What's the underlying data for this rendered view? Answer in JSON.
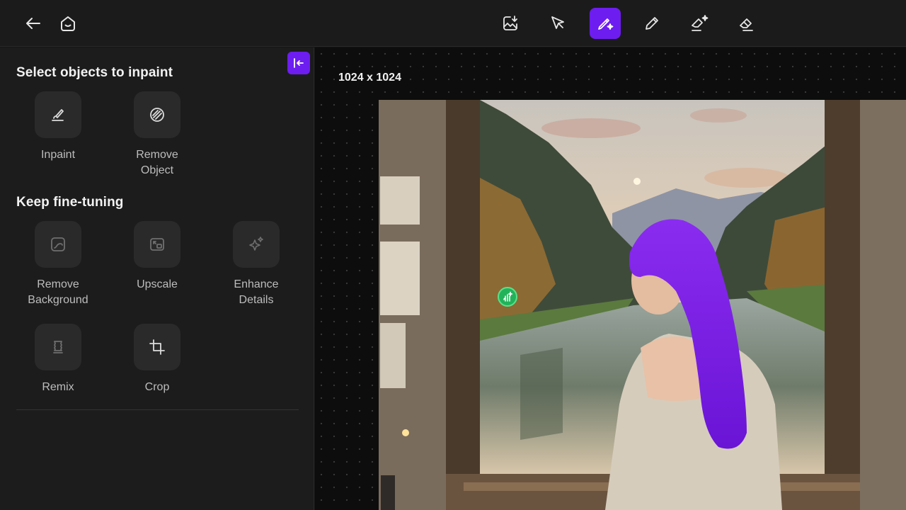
{
  "toolbar": {
    "back_icon": "arrow-left-icon",
    "home_icon": "home-icon",
    "tools": [
      {
        "name": "save-image-icon",
        "active": false
      },
      {
        "name": "select-cursor-icon",
        "active": false
      },
      {
        "name": "magic-brush-icon",
        "active": true
      },
      {
        "name": "pencil-icon",
        "active": false
      },
      {
        "name": "magic-eraser-icon",
        "active": false
      },
      {
        "name": "eraser-icon",
        "active": false
      }
    ],
    "accent_color": "#6d1df0"
  },
  "sidebar": {
    "collapse_icon": "collapse-left-icon",
    "inpaint_section": {
      "title": "Select objects to inpaint",
      "tools": [
        {
          "label": "Inpaint",
          "icon": "brush-icon"
        },
        {
          "label": "Remove Object",
          "line1": "Remove",
          "line2": "Object",
          "icon": "remove-object-icon"
        }
      ]
    },
    "finetune_section": {
      "title": "Keep fine-tuning",
      "tools": [
        {
          "label": "Remove Background",
          "line1": "Remove",
          "line2": "Background",
          "icon": "remove-background-icon"
        },
        {
          "label": "Upscale",
          "icon": "upscale-icon"
        },
        {
          "label": "Enhance Details",
          "line1": "Enhance",
          "line2": "Details",
          "icon": "sparkle-icon"
        },
        {
          "label": "Remix",
          "icon": "remix-icon"
        },
        {
          "label": "Crop",
          "icon": "crop-icon"
        }
      ]
    }
  },
  "canvas": {
    "dimensions": "1024 x 1024",
    "highlight_color": "#7a1ee0",
    "cursor_color": "#22b35a"
  }
}
